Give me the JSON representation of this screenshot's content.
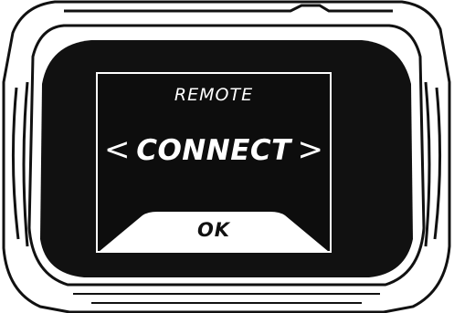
{
  "screen": {
    "title": "REMOTE",
    "option": "CONNECT",
    "prev_glyph": "<",
    "next_glyph": ">",
    "confirm_label": "OK"
  },
  "colors": {
    "screen_background": "#111111",
    "text": "#ffffff",
    "confirm_fill": "#ffffff",
    "confirm_text": "#111111"
  },
  "icons": {
    "prev": "chevron-left-icon",
    "next": "chevron-right-icon"
  }
}
